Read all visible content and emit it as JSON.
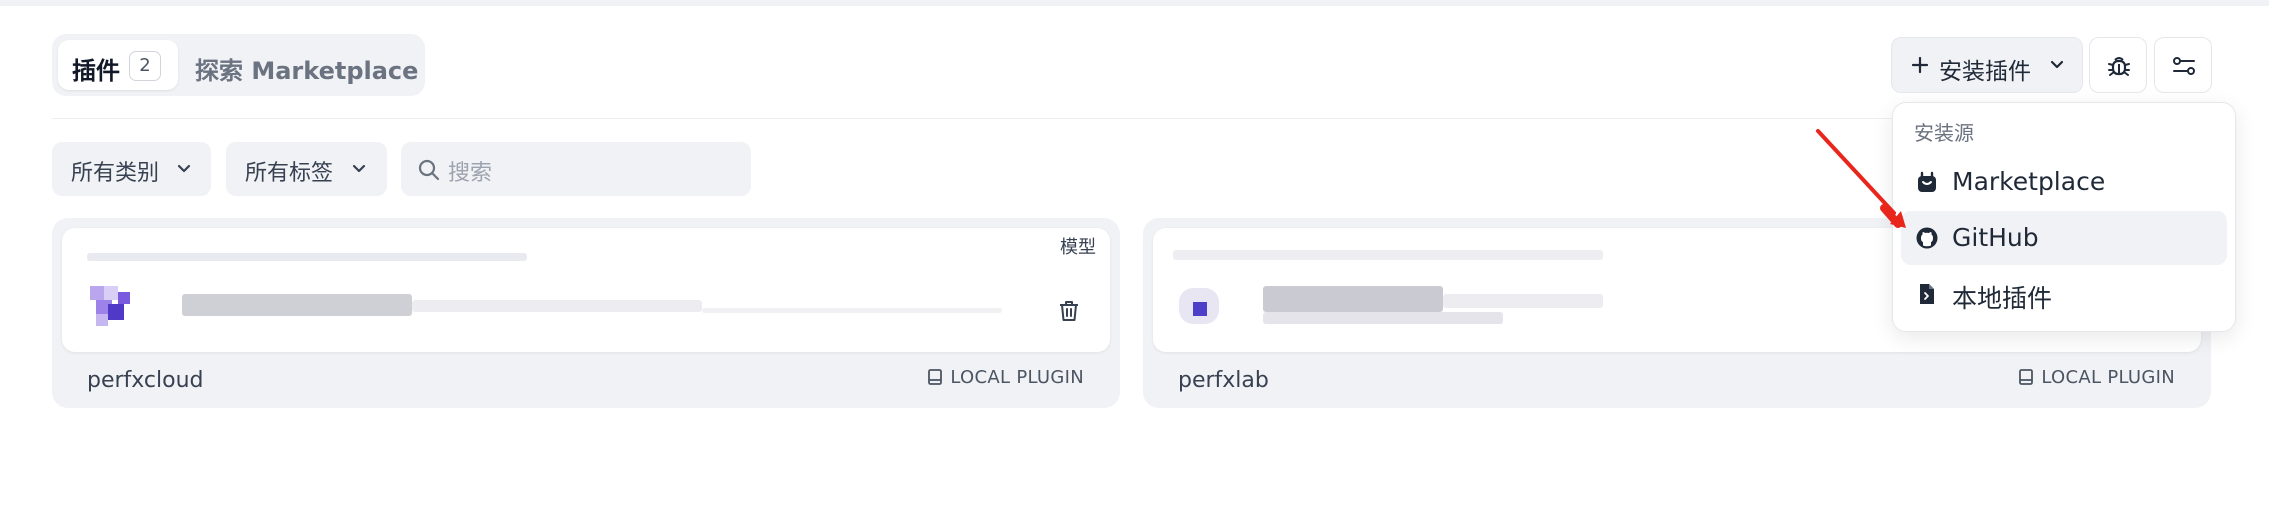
{
  "tabs": {
    "plugins_label": "插件",
    "plugins_count": "2",
    "marketplace_label": "探索 Marketplace"
  },
  "filters": {
    "category_label": "所有类别",
    "tags_label": "所有标签",
    "search_placeholder": "搜索"
  },
  "toolbar": {
    "install_label": "安装插件",
    "debug_icon": "bug-icon",
    "settings_icon": "sliders-icon"
  },
  "install_menu": {
    "title": "安装源",
    "items": [
      {
        "label": "Marketplace",
        "icon": "marketplace-icon"
      },
      {
        "label": "GitHub",
        "icon": "github-icon"
      },
      {
        "label": "本地插件",
        "icon": "local-file-icon"
      }
    ]
  },
  "plugins": [
    {
      "category": "模型",
      "owner": "perfxcloud",
      "source_tag": "LOCAL PLUGIN"
    },
    {
      "category": "",
      "owner": "perfxlab",
      "source_tag": "LOCAL PLUGIN"
    }
  ],
  "colors": {
    "annotation_arrow": "#e8261c",
    "plugin_icon_purple": "#6b47d8"
  }
}
